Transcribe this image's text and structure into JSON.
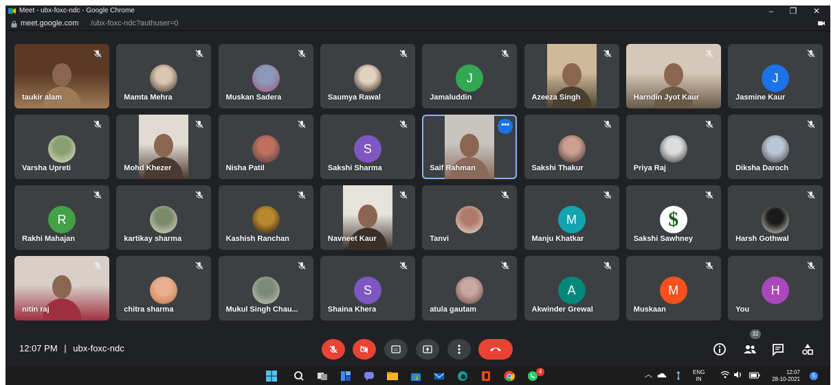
{
  "window": {
    "title": "Meet - ubx-foxc-ndc - Google Chrome",
    "minimize": "–",
    "restore": "❐",
    "close": "✕"
  },
  "address": {
    "host": "meet.google.com",
    "path": "/ubx-foxc-ndc?authuser=0"
  },
  "participants": [
    {
      "name": "taukir alam",
      "kind": "video",
      "colors": [
        "#5a3a25",
        "#9e7a55"
      ]
    },
    {
      "name": "Mamta Mehra",
      "kind": "photo",
      "colors": [
        "#d9c6b0",
        "#3a2a20"
      ]
    },
    {
      "name": "Muskan Sadera",
      "kind": "photo",
      "colors": [
        "#8a9ab8",
        "#b05080"
      ]
    },
    {
      "name": "Saumya Rawal",
      "kind": "photo",
      "colors": [
        "#e2d2c0",
        "#2a1a14"
      ]
    },
    {
      "name": "Jamaluddin",
      "kind": "letter",
      "letter": "J",
      "color": "#33a853"
    },
    {
      "name": "Azeeza Singh",
      "kind": "video",
      "colors": [
        "#d0b89a",
        "#4a4030"
      ]
    },
    {
      "name": "Harndin Jyot Kaur",
      "kind": "video",
      "colors": [
        "#d6c8b8",
        "#6a5a48"
      ]
    },
    {
      "name": "Jasmine Kaur",
      "kind": "letter",
      "letter": "J",
      "color": "#1a73e8"
    },
    {
      "name": "Varsha Upreti",
      "kind": "photo",
      "colors": [
        "#8aa070",
        "#e8e0d0"
      ]
    },
    {
      "name": "Mohd Khezer",
      "kind": "video",
      "colors": [
        "#e0dcd4",
        "#4a3a30"
      ]
    },
    {
      "name": "Nisha Patil",
      "kind": "photo",
      "colors": [
        "#c07060",
        "#4a3a40"
      ]
    },
    {
      "name": "Sakshi Sharma",
      "kind": "letter",
      "letter": "S",
      "color": "#7e57c2"
    },
    {
      "name": "Saif Rahman",
      "kind": "video",
      "colors": [
        "#c8c4c0",
        "#8a6a58"
      ],
      "active": true
    },
    {
      "name": "Sakshi Thakur",
      "kind": "photo",
      "colors": [
        "#caa090",
        "#3a2a28"
      ]
    },
    {
      "name": "Priya Raj",
      "kind": "photo",
      "colors": [
        "#dcdcdc",
        "#2a2a2a"
      ]
    },
    {
      "name": "Diksha Daroch",
      "kind": "photo",
      "colors": [
        "#b8c8d8",
        "#4a3830"
      ]
    },
    {
      "name": "Rakhi Mahajan",
      "kind": "letter",
      "letter": "R",
      "color": "#43a047"
    },
    {
      "name": "kartikay sharma",
      "kind": "photo",
      "colors": [
        "#7a8a6a",
        "#e8dcd0"
      ]
    },
    {
      "name": "Kashish Ranchan",
      "kind": "photo",
      "colors": [
        "#b88a30",
        "#2a1a10"
      ]
    },
    {
      "name": "Navneet Kaur",
      "kind": "video",
      "colors": [
        "#e6e2dc",
        "#3a302a"
      ]
    },
    {
      "name": "Tanvi",
      "kind": "photo",
      "colors": [
        "#b07a6a",
        "#e8e0d8"
      ]
    },
    {
      "name": "Manju Khatkar",
      "kind": "letter",
      "letter": "M",
      "color": "#12a4af"
    },
    {
      "name": "Sakshi Sawhney",
      "kind": "logo",
      "letter": "$",
      "color": "#ffffff"
    },
    {
      "name": "Harsh Gothwal",
      "kind": "photo",
      "colors": [
        "#1a1a1a",
        "#e8e0d0"
      ]
    },
    {
      "name": "nitin raj",
      "kind": "video",
      "colors": [
        "#d8d0c8",
        "#a03040"
      ]
    },
    {
      "name": "chitra sharma",
      "kind": "photo",
      "colors": [
        "#e8b090",
        "#c87040"
      ]
    },
    {
      "name": "Mukul Singh Chau...",
      "kind": "photo",
      "colors": [
        "#7a8a7a",
        "#d0c8b8"
      ]
    },
    {
      "name": "Shaina Khera",
      "kind": "letter",
      "letter": "S",
      "color": "#7e57c2"
    },
    {
      "name": "atula gautam",
      "kind": "photo",
      "colors": [
        "#c8a8a0",
        "#6a4038"
      ]
    },
    {
      "name": "Akwinder Grewal",
      "kind": "letter",
      "letter": "A",
      "color": "#00897b"
    },
    {
      "name": "Muskaan",
      "kind": "letter",
      "letter": "M",
      "color": "#f4511e"
    },
    {
      "name": "You",
      "kind": "letter",
      "letter": "H",
      "color": "#ab47bc"
    }
  ],
  "meeting": {
    "time": "12:07 PM",
    "separator": "|",
    "code": "ubx-foxc-ndc"
  },
  "controls": [
    {
      "name": "mic-off-button",
      "icon": "mic-off-icon"
    },
    {
      "name": "camera-off-button",
      "icon": "camera-off-icon"
    },
    {
      "name": "captions-button",
      "icon": "captions-icon"
    },
    {
      "name": "present-button",
      "icon": "present-icon"
    },
    {
      "name": "more-options-button",
      "icon": "more-vert-icon"
    },
    {
      "name": "leave-call-button",
      "icon": "call-end-icon"
    }
  ],
  "people_count": "32",
  "taskbar": {
    "lang1": "ENG",
    "lang2": "IN",
    "time": "12:07",
    "date": "28-10-2021",
    "notif": "5",
    "whatsapp_badge": "4"
  }
}
